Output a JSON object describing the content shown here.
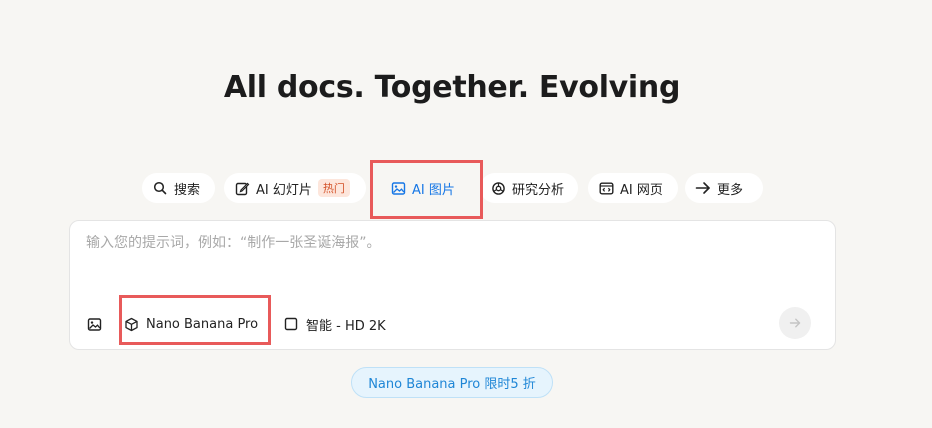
{
  "headline": "All docs. Together. Evolving",
  "tabs": [
    {
      "label": "搜索",
      "icon": "search-icon"
    },
    {
      "label": "AI 幻灯片",
      "icon": "edit-slides-icon",
      "badge": "热门"
    },
    {
      "label": "AI 图片",
      "icon": "image-icon",
      "active": true
    },
    {
      "label": "研究分析",
      "icon": "research-icon"
    },
    {
      "label": "AI 网页",
      "icon": "web-code-icon"
    },
    {
      "label": "更多",
      "icon": "arrow-right-icon"
    }
  ],
  "composer": {
    "placeholder": "输入您的提示词，例如：“制作一张圣诞海报”。",
    "value": "",
    "toolbar": {
      "image_upload_icon": "image-icon",
      "model_label": "Nano Banana Pro",
      "model_icon": "cube-icon",
      "quality_label": "智能 - HD 2K",
      "quality_icon": "square-icon"
    },
    "send_icon": "arrow-right-icon"
  },
  "promo": "Nano Banana Pro 限时5 折",
  "colors": {
    "accent": "#1677e6",
    "highlight": "#e85a5a",
    "hot_badge_bg": "#fde6dc",
    "hot_badge_text": "#d4542b",
    "promo_bg": "#e6f4fd",
    "promo_text": "#1f86d6",
    "page_bg": "#f7f6f3"
  }
}
